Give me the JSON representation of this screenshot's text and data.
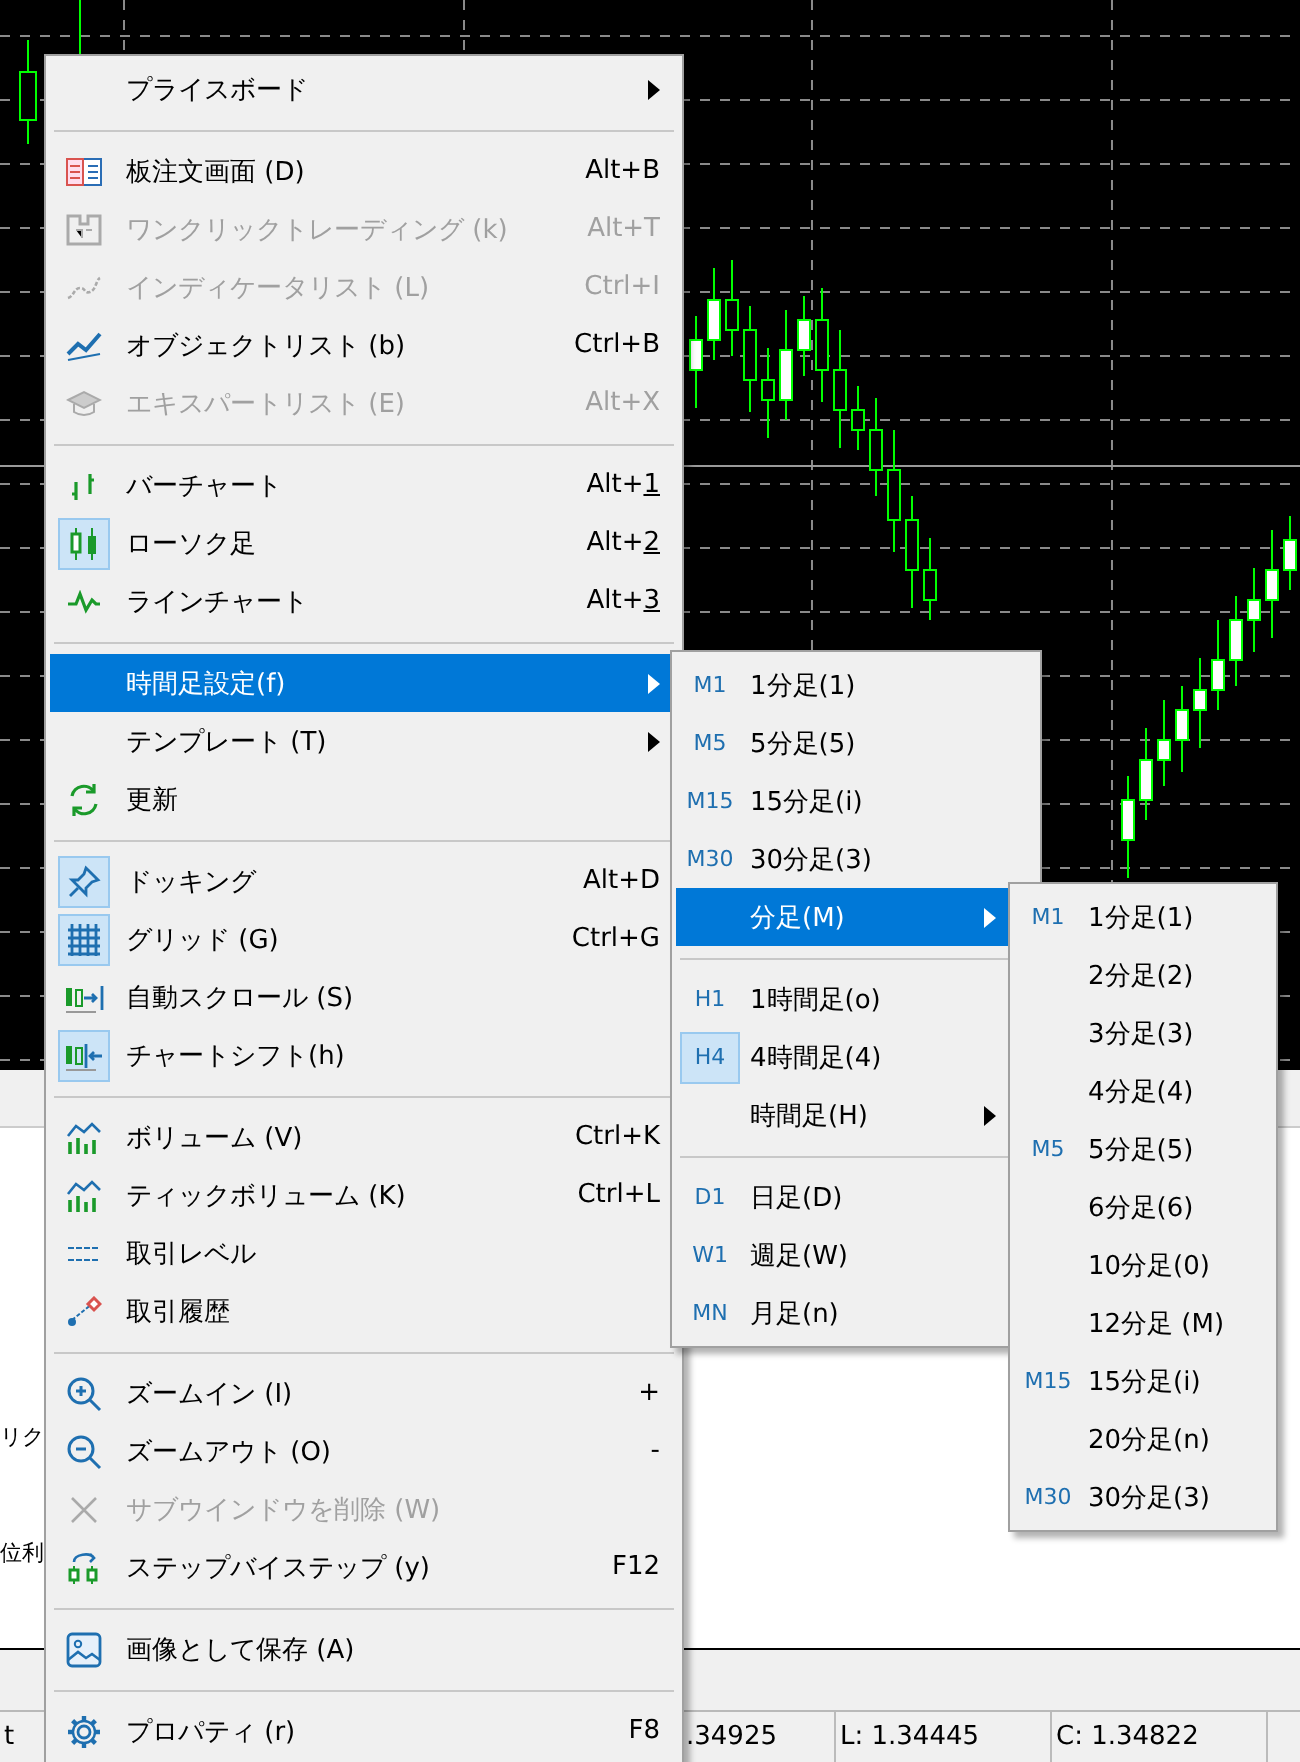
{
  "main_menu": {
    "sections": [
      {
        "items": [
          {
            "label": "プライスボード",
            "disabled": false,
            "checked": false,
            "selected": false,
            "submenu": true
          }
        ]
      },
      {
        "items": [
          {
            "label": "板注文画面 (D)",
            "shortcut": "Alt+B",
            "disabled": false,
            "checked": false,
            "selected": false,
            "submenu": false
          },
          {
            "label": "ワンクリックトレーディング (k)",
            "shortcut": "Alt+T",
            "disabled": true,
            "checked": false,
            "selected": false,
            "submenu": false
          },
          {
            "label": "インディケータリスト (L)",
            "shortcut": "Ctrl+I",
            "disabled": true,
            "checked": false,
            "selected": false,
            "submenu": false
          },
          {
            "label": "オブジェクトリスト (b)",
            "shortcut": "Ctrl+B",
            "disabled": false,
            "checked": false,
            "selected": false,
            "submenu": false
          },
          {
            "label": "エキスパートリスト (E)",
            "shortcut": "Alt+X",
            "disabled": true,
            "checked": false,
            "selected": false,
            "submenu": false
          }
        ]
      },
      {
        "items": [
          {
            "label": "バーチャート",
            "shortcut": "Alt+1",
            "underline_key": true,
            "disabled": false,
            "checked": false,
            "selected": false,
            "submenu": false
          },
          {
            "label": "ローソク足",
            "shortcut": "Alt+2",
            "underline_key": true,
            "disabled": false,
            "checked": true,
            "selected": false,
            "submenu": false
          },
          {
            "label": "ラインチャート",
            "shortcut": "Alt+3",
            "underline_key": true,
            "disabled": false,
            "checked": false,
            "selected": false,
            "submenu": false
          }
        ]
      },
      {
        "items": [
          {
            "label": "時間足設定(f)",
            "disabled": false,
            "checked": false,
            "selected": true,
            "submenu": true
          },
          {
            "label": "テンプレート (T)",
            "disabled": false,
            "checked": false,
            "selected": false,
            "submenu": true
          },
          {
            "label": "更新",
            "disabled": false,
            "checked": false,
            "selected": false,
            "submenu": false
          }
        ]
      },
      {
        "items": [
          {
            "label": "ドッキング",
            "shortcut": "Alt+D",
            "disabled": false,
            "checked": true,
            "selected": false,
            "submenu": false
          },
          {
            "label": "グリッド (G)",
            "shortcut": "Ctrl+G",
            "disabled": false,
            "checked": true,
            "selected": false,
            "submenu": false
          },
          {
            "label": "自動スクロール (S)",
            "disabled": false,
            "checked": false,
            "selected": false,
            "submenu": false
          },
          {
            "label": "チャートシフト(h)",
            "disabled": false,
            "checked": true,
            "selected": false,
            "submenu": false
          }
        ]
      },
      {
        "items": [
          {
            "label": "ボリューム (V)",
            "shortcut": "Ctrl+K",
            "disabled": false,
            "checked": false,
            "selected": false,
            "submenu": false
          },
          {
            "label": "ティックボリューム (K)",
            "shortcut": "Ctrl+L",
            "disabled": false,
            "checked": false,
            "selected": false,
            "submenu": false
          },
          {
            "label": "取引レベル",
            "disabled": false,
            "checked": false,
            "selected": false,
            "submenu": false
          },
          {
            "label": "取引履歴",
            "disabled": false,
            "checked": false,
            "selected": false,
            "submenu": false
          }
        ]
      },
      {
        "items": [
          {
            "label": "ズームイン (I)",
            "shortcut": "+",
            "disabled": false,
            "checked": false,
            "selected": false,
            "submenu": false
          },
          {
            "label": "ズームアウト (O)",
            "shortcut": "-",
            "disabled": false,
            "checked": false,
            "selected": false,
            "submenu": false
          },
          {
            "label": "サブウインドウを削除 (W)",
            "disabled": true,
            "checked": false,
            "selected": false,
            "submenu": false
          },
          {
            "label": "ステップバイステップ (y)",
            "shortcut": "F12",
            "disabled": false,
            "checked": false,
            "selected": false,
            "submenu": false
          }
        ]
      },
      {
        "items": [
          {
            "label": "画像として保存 (A)",
            "disabled": false,
            "checked": false,
            "selected": false,
            "submenu": false
          }
        ]
      },
      {
        "items": [
          {
            "label": "プロパティ (r)",
            "shortcut": "F8",
            "disabled": false,
            "checked": false,
            "selected": false,
            "submenu": false
          }
        ]
      }
    ]
  },
  "timeframe_submenu": {
    "sections": [
      {
        "items": [
          {
            "tag": "M1",
            "label": "1分足(1)",
            "checked": false,
            "selected": false,
            "submenu": false
          },
          {
            "tag": "M5",
            "label": "5分足(5)",
            "checked": false,
            "selected": false,
            "submenu": false
          },
          {
            "tag": "M15",
            "label": "15分足(i)",
            "checked": false,
            "selected": false,
            "submenu": false
          },
          {
            "tag": "M30",
            "label": "30分足(3)",
            "checked": false,
            "selected": false,
            "submenu": false
          },
          {
            "label": "分足(M)",
            "checked": false,
            "selected": true,
            "submenu": true
          }
        ]
      },
      {
        "items": [
          {
            "tag": "H1",
            "label": "1時間足(o)",
            "checked": false,
            "selected": false,
            "submenu": false
          },
          {
            "tag": "H4",
            "label": "4時間足(4)",
            "checked": true,
            "selected": false,
            "submenu": false
          },
          {
            "label": "時間足(H)",
            "checked": false,
            "selected": false,
            "submenu": true
          }
        ]
      },
      {
        "items": [
          {
            "tag": "D1",
            "label": "日足(D)",
            "checked": false,
            "selected": false,
            "submenu": false
          },
          {
            "tag": "W1",
            "label": "週足(W)",
            "checked": false,
            "selected": false,
            "submenu": false
          },
          {
            "tag": "MN",
            "label": "月足(n)",
            "checked": false,
            "selected": false,
            "submenu": false
          }
        ]
      }
    ]
  },
  "minute_submenu": {
    "items": [
      {
        "tag": "M1",
        "label": "1分足(1)"
      },
      {
        "label": "2分足(2)"
      },
      {
        "label": "3分足(3)"
      },
      {
        "label": "4分足(4)"
      },
      {
        "tag": "M5",
        "label": "5分足(5)"
      },
      {
        "label": "6分足(6)"
      },
      {
        "label": "10分足(0)"
      },
      {
        "label": "12分足 (M)"
      },
      {
        "tag": "M15",
        "label": "15分足(i)"
      },
      {
        "label": "20分足(n)"
      },
      {
        "tag": "M30",
        "label": "30分足(3)"
      }
    ]
  },
  "side_texts": [
    "リク",
    "位利"
  ],
  "status_bar": {
    "cells": [
      "t",
      ".34925",
      "L: 1.34445",
      "C: 1.34822"
    ]
  }
}
